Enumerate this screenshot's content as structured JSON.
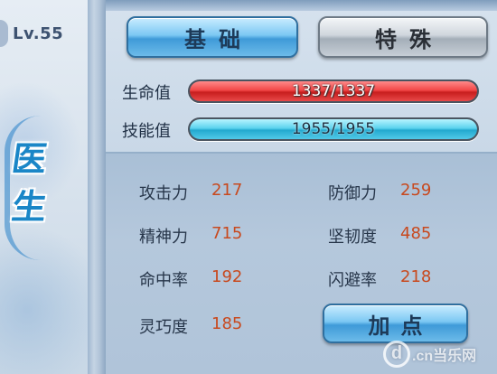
{
  "character": {
    "level": "Lv.55",
    "class_name_line1": "医",
    "class_name_line2": "生"
  },
  "tabs": {
    "basic_label": "基础",
    "special_label": "特殊",
    "active": "basic"
  },
  "bars": {
    "hp": {
      "label": "生命值",
      "text": "1337/1337",
      "current": 1337,
      "max": 1337,
      "color": "#e83c3c"
    },
    "sp": {
      "label": "技能值",
      "text": "1955/1955",
      "current": 1955,
      "max": 1955,
      "color": "#3fc3e3"
    }
  },
  "stats": {
    "attack": {
      "name": "攻击力",
      "value": "217"
    },
    "defense": {
      "name": "防御力",
      "value": "259"
    },
    "spirit": {
      "name": "精神力",
      "value": "715"
    },
    "toughness": {
      "name": "坚韧度",
      "value": "485"
    },
    "accuracy": {
      "name": "命中率",
      "value": "192"
    },
    "dodge": {
      "name": "闪避率",
      "value": "218"
    },
    "dexterity": {
      "name": "灵巧度",
      "value": "185"
    }
  },
  "buttons": {
    "add_points_label": "加点"
  },
  "watermark": {
    "logo_letter": "d",
    "text": ".cn当乐网"
  },
  "colors": {
    "stat_value": "#c8491e",
    "class_glyph": "#1a86c7",
    "accent_button": "#3f9ad8"
  }
}
